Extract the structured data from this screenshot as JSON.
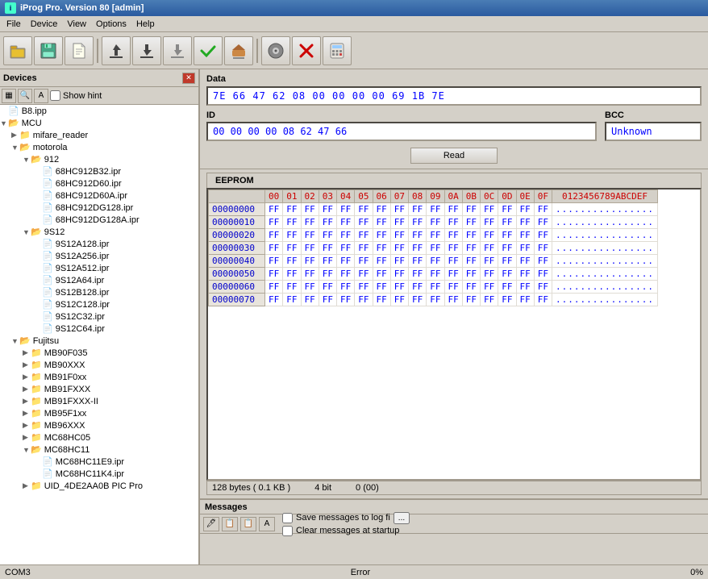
{
  "titlebar": {
    "title": "iProg Pro. Version 80 [admin]",
    "icon": "i"
  },
  "menubar": {
    "items": [
      "File",
      "Device",
      "View",
      "Options",
      "Help"
    ]
  },
  "toolbar": {
    "buttons": [
      {
        "name": "open-icon",
        "icon": "📂"
      },
      {
        "name": "save-icon",
        "icon": "💾"
      },
      {
        "name": "new-icon",
        "icon": "📄"
      },
      {
        "name": "write-icon",
        "icon": "✍"
      },
      {
        "name": "upload-icon",
        "icon": "⬆"
      },
      {
        "name": "download-icon",
        "icon": "⬇"
      },
      {
        "name": "download2-icon",
        "icon": "⬇"
      },
      {
        "name": "verify-icon",
        "icon": "✔"
      },
      {
        "name": "erase-icon",
        "icon": "🖊"
      },
      {
        "name": "disk-icon",
        "icon": "💿"
      },
      {
        "name": "stop-icon",
        "icon": "✖"
      },
      {
        "name": "calc-icon",
        "icon": "🧮"
      }
    ]
  },
  "devices_panel": {
    "title": "Devices",
    "show_hint_label": "Show hint",
    "tree": [
      {
        "level": 0,
        "type": "file",
        "label": "B8.ipp",
        "icon": "📄"
      },
      {
        "level": 0,
        "type": "folder",
        "label": "MCU",
        "icon": "📁",
        "expanded": true
      },
      {
        "level": 1,
        "type": "folder",
        "label": "mifare_reader",
        "icon": "📁"
      },
      {
        "level": 1,
        "type": "folder",
        "label": "motorola",
        "icon": "📁",
        "expanded": true
      },
      {
        "level": 2,
        "type": "folder",
        "label": "912",
        "icon": "📁",
        "expanded": true
      },
      {
        "level": 3,
        "type": "file",
        "label": "68HC912B32.ipr",
        "icon": "📄"
      },
      {
        "level": 3,
        "type": "file",
        "label": "68HC912D60.ipr",
        "icon": "📄"
      },
      {
        "level": 3,
        "type": "file",
        "label": "68HC912D60A.ipr",
        "icon": "📄"
      },
      {
        "level": 3,
        "type": "file",
        "label": "68HC912DG128.ipr",
        "icon": "📄"
      },
      {
        "level": 3,
        "type": "file",
        "label": "68HC912DG128A.ipr",
        "icon": "📄"
      },
      {
        "level": 2,
        "type": "folder",
        "label": "9S12",
        "icon": "📁",
        "expanded": true
      },
      {
        "level": 3,
        "type": "file",
        "label": "9S12A128.ipr",
        "icon": "📄"
      },
      {
        "level": 3,
        "type": "file",
        "label": "9S12A256.ipr",
        "icon": "📄"
      },
      {
        "level": 3,
        "type": "file",
        "label": "9S12A512.ipr",
        "icon": "📄"
      },
      {
        "level": 3,
        "type": "file",
        "label": "9S12A64.ipr",
        "icon": "📄"
      },
      {
        "level": 3,
        "type": "file",
        "label": "9S12B128.ipr",
        "icon": "📄"
      },
      {
        "level": 3,
        "type": "file",
        "label": "9S12C128.ipr",
        "icon": "📄"
      },
      {
        "level": 3,
        "type": "file",
        "label": "9S12C32.ipr",
        "icon": "📄"
      },
      {
        "level": 3,
        "type": "file",
        "label": "9S12C64.ipr",
        "icon": "📄"
      },
      {
        "level": 1,
        "type": "folder",
        "label": "Fujitsu",
        "icon": "📁",
        "expanded": true
      },
      {
        "level": 2,
        "type": "folder",
        "label": "MB90F035",
        "icon": "📁"
      },
      {
        "level": 2,
        "type": "folder",
        "label": "MB90XXX",
        "icon": "📁"
      },
      {
        "level": 2,
        "type": "folder",
        "label": "MB91F0xx",
        "icon": "📁"
      },
      {
        "level": 2,
        "type": "folder",
        "label": "MB91FXXX",
        "icon": "📁"
      },
      {
        "level": 2,
        "type": "folder",
        "label": "MB91FXXX-II",
        "icon": "📁"
      },
      {
        "level": 2,
        "type": "folder",
        "label": "MB95F1xx",
        "icon": "📁"
      },
      {
        "level": 2,
        "type": "folder",
        "label": "MB96XXX",
        "icon": "📁"
      },
      {
        "level": 2,
        "type": "folder",
        "label": "MC68HC05",
        "icon": "📁"
      },
      {
        "level": 2,
        "type": "folder",
        "label": "MC68HC11",
        "icon": "📁",
        "expanded": true
      },
      {
        "level": 3,
        "type": "file",
        "label": "MC68HC11E9.ipr",
        "icon": "📄"
      },
      {
        "level": 3,
        "type": "file",
        "label": "MC68HC11K4.ipr",
        "icon": "📄"
      },
      {
        "level": 2,
        "type": "folder",
        "label": "UID_4DE2AA0B  PIC Pro",
        "icon": "📁"
      }
    ]
  },
  "data_section": {
    "label": "Data",
    "hex_value": "7E  66  47  62  08  00  00  00  00  69  1B  7E",
    "id_label": "ID",
    "id_value": "00  00  00  00  08  62  47  66",
    "bcc_label": "BCC",
    "bcc_value": "Unknown",
    "read_button": "Read"
  },
  "eeprom_section": {
    "tab_label": "EEPROM",
    "columns": [
      "00",
      "01",
      "02",
      "03",
      "04",
      "05",
      "06",
      "07",
      "08",
      "09",
      "0A",
      "0B",
      "0C",
      "0D",
      "0E",
      "0F"
    ],
    "ascii_header": "0123456789ABCDEF",
    "rows": [
      {
        "addr": "00000000",
        "hex": [
          "FF",
          "FF",
          "FF",
          "FF",
          "FF",
          "FF",
          "FF",
          "FF",
          "FF",
          "FF",
          "FF",
          "FF",
          "FF",
          "FF",
          "FF",
          "FF"
        ],
        "ascii": "................"
      },
      {
        "addr": "00000010",
        "hex": [
          "FF",
          "FF",
          "FF",
          "FF",
          "FF",
          "FF",
          "FF",
          "FF",
          "FF",
          "FF",
          "FF",
          "FF",
          "FF",
          "FF",
          "FF",
          "FF"
        ],
        "ascii": "................"
      },
      {
        "addr": "00000020",
        "hex": [
          "FF",
          "FF",
          "FF",
          "FF",
          "FF",
          "FF",
          "FF",
          "FF",
          "FF",
          "FF",
          "FF",
          "FF",
          "FF",
          "FF",
          "FF",
          "FF"
        ],
        "ascii": "................"
      },
      {
        "addr": "00000030",
        "hex": [
          "FF",
          "FF",
          "FF",
          "FF",
          "FF",
          "FF",
          "FF",
          "FF",
          "FF",
          "FF",
          "FF",
          "FF",
          "FF",
          "FF",
          "FF",
          "FF"
        ],
        "ascii": "................"
      },
      {
        "addr": "00000040",
        "hex": [
          "FF",
          "FF",
          "FF",
          "FF",
          "FF",
          "FF",
          "FF",
          "FF",
          "FF",
          "FF",
          "FF",
          "FF",
          "FF",
          "FF",
          "FF",
          "FF"
        ],
        "ascii": "................"
      },
      {
        "addr": "00000050",
        "hex": [
          "FF",
          "FF",
          "FF",
          "FF",
          "FF",
          "FF",
          "FF",
          "FF",
          "FF",
          "FF",
          "FF",
          "FF",
          "FF",
          "FF",
          "FF",
          "FF"
        ],
        "ascii": "................"
      },
      {
        "addr": "00000060",
        "hex": [
          "FF",
          "FF",
          "FF",
          "FF",
          "FF",
          "FF",
          "FF",
          "FF",
          "FF",
          "FF",
          "FF",
          "FF",
          "FF",
          "FF",
          "FF",
          "FF"
        ],
        "ascii": "................"
      },
      {
        "addr": "00000070",
        "hex": [
          "FF",
          "FF",
          "FF",
          "FF",
          "FF",
          "FF",
          "FF",
          "FF",
          "FF",
          "FF",
          "FF",
          "FF",
          "FF",
          "FF",
          "FF",
          "FF"
        ],
        "ascii": "................"
      }
    ],
    "status_size": "128 bytes ( 0.1 KB )",
    "status_bits": "4 bit",
    "status_value": "0 (00)"
  },
  "messages_section": {
    "label": "Messages",
    "save_label": "Save messages to log fi",
    "browse_label": "...",
    "clear_label": "Clear messages at startup"
  },
  "statusbar": {
    "left": "COM3",
    "middle": "Error",
    "right": "0%"
  }
}
